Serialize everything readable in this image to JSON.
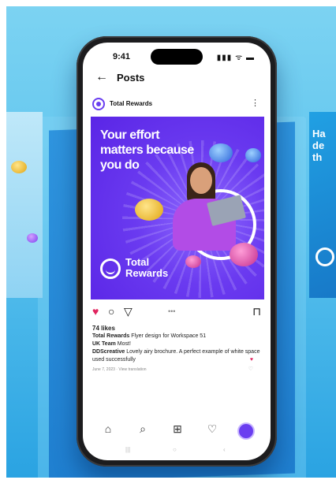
{
  "status": {
    "time": "9:41",
    "indicators": "▮▮▮ ᯤ ▬"
  },
  "header": {
    "back_icon": "←",
    "title": "Posts"
  },
  "post": {
    "account": "Total Rewards",
    "more_icon": "⋮",
    "image": {
      "headline": "Your effort\nmatters because\nyou do",
      "brand": "Total\nRewards"
    },
    "actions": {
      "heart": "♥",
      "comment": "○",
      "share": "▽",
      "dots": "•••",
      "bookmark": "⊓"
    },
    "likes": "74 likes",
    "caption_user": "Total Rewards",
    "caption_text": "Flyer design for Workspace 51",
    "comment1_user": "UK Team",
    "comment1_text": "Most!",
    "comment2_user": "DDScreative",
    "comment2_text": "Lovely airy brochure. A perfect example of white space used successfully",
    "meta": "June 7, 2023 · View translation"
  },
  "tabbar": {
    "home": "⌂",
    "search": "⌕",
    "add": "⊞",
    "activity": "♡"
  },
  "navbar": {
    "n1": "|||",
    "n2": "○",
    "n3": "‹"
  },
  "side_right_text": "Ha\nde\nth",
  "colors": {
    "accent": "#6a3ef0",
    "background": "#5cc3ee",
    "like": "#e0245e"
  }
}
